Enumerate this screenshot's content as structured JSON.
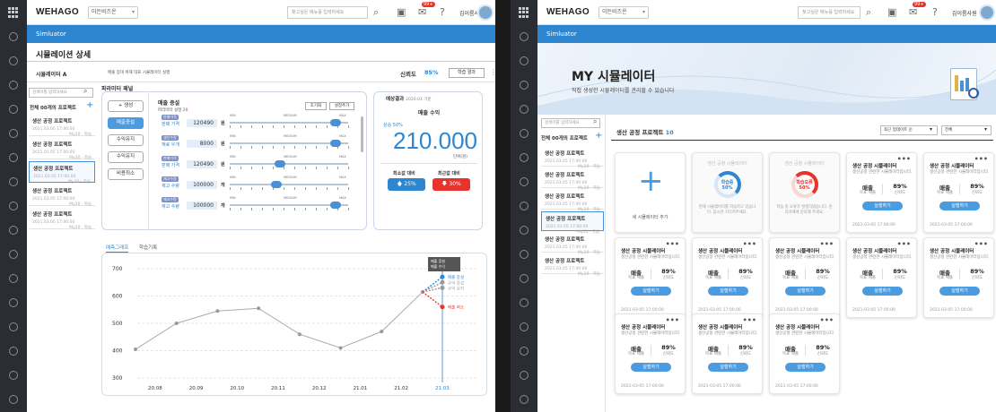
{
  "common": {
    "app_name": "WEHAGO",
    "corp_select": "이든비즈온",
    "search_placeholder": "찾고싶은 메뉴를 입력하세요",
    "user_name": "김이름사원",
    "chat_badge": "99+",
    "banner": "Simluator"
  },
  "left": {
    "page_title": "시뮬레이션 상세",
    "sim_name": "시뮬레이터 A",
    "sim_desc": "매출 증대 위해 대표 시뮬레이터 실행",
    "reliability_label": "신뢰도",
    "reliability_value": "85%",
    "learn_result_btn": "학습 결과",
    "list_search_placeholder": "검색어를 입력하세요",
    "project_header": "전체 00개의 프로젝트",
    "projects": [
      {
        "name": "생산 공정 프로젝트",
        "date": "2021.03.05 17:00:00",
        "meta": "My20 · 학습"
      },
      {
        "name": "생산 공정 프로젝트",
        "date": "2021.03.05 17:00:00",
        "meta": "My20 · 학습"
      },
      {
        "name": "생산 공정 프로젝트",
        "date": "2021.03.05 17:00:00",
        "meta": "My20 · 학습"
      },
      {
        "name": "생산 공정 프로젝트",
        "date": "2021.03.05 17:00:00",
        "meta": "My20 · 학습"
      },
      {
        "name": "생산 공정 프로젝트",
        "date": "2021.03.05 17:00:00",
        "meta": "My20 · 학습"
      }
    ],
    "param_panel_title": "파라미터 패널",
    "ops": [
      "+ 생성",
      "매출증설",
      "수익유지",
      "수익유지",
      "비용최소"
    ],
    "panel_title": "매출 증설",
    "panel_sub": "파라미터 설정",
    "panel_sub_count": "20",
    "reset_btn": "초기화",
    "add_btn": "설정추가",
    "params": [
      {
        "chip": "판매가격",
        "label": "판매 가격",
        "value": "120490",
        "unit": "원"
      },
      {
        "chip": "생산수량",
        "label": "재료 우개",
        "value": "8000",
        "unit": "원"
      },
      {
        "chip": "판매가격",
        "label": "판매 가격",
        "value": "120490",
        "unit": "원"
      },
      {
        "chip": "재고수량",
        "label": "재고 수량",
        "value": "100000",
        "unit": "개"
      },
      {
        "chip": "재고수량",
        "label": "재고 수량",
        "value": "100000",
        "unit": "개"
      }
    ],
    "slider_min": "MIN",
    "slider_mid": "MEDIUM",
    "slider_max": "MAX",
    "result_title": "예상결과",
    "result_date": "2020.03 기준",
    "result_metric": "매출 수익",
    "result_rate": "상승 50%",
    "result_value": "210.000",
    "result_unit": "단위(원)",
    "min_label": "최소값 대비",
    "min_value": "25%",
    "max_label": "최근값 대비",
    "max_value": "30%",
    "tabs": [
      "예측그래프",
      "학습기록"
    ],
    "tooltip_l1": "매출 증설",
    "tooltip_l2": "매출 수익",
    "legend": [
      "매출 증설",
      "수익 증설",
      "수익 유지",
      "매출 최소"
    ]
  },
  "chart_data": {
    "type": "line",
    "x": [
      "20.08",
      "20.09",
      "20.10",
      "20.11",
      "20.12",
      "21.01",
      "21.02",
      "21.03"
    ],
    "ylim": [
      300,
      700
    ],
    "yticks": [
      300,
      400,
      500,
      600,
      700
    ],
    "series": [
      {
        "values": [
          405,
          500,
          545,
          555,
          460,
          410,
          470,
          615
        ]
      }
    ],
    "projections": [
      {
        "name": "매출 증설",
        "end": 670,
        "color": "#2f86d0"
      },
      {
        "name": "수익 증설",
        "end": 650,
        "color": "#999999"
      },
      {
        "name": "수익 유지",
        "end": 630,
        "color": "#999999"
      },
      {
        "name": "매출 최소",
        "end": 560,
        "color": "#e8322b"
      }
    ]
  },
  "right": {
    "hero_title": "MY 시뮬레이터",
    "hero_sub": "직접 생성한 시뮬레이터를 관리할 수 있습니다",
    "list_search_placeholder": "검색어를 입력하세요",
    "project_header": "전체 00개의 프로젝트",
    "projects": [
      {
        "name": "생산 공정 프로젝트",
        "date": "2021.03.05 17:00:00",
        "meta": "My20 · 학습"
      },
      {
        "name": "생산 공정 프로젝트",
        "date": "2021.03.05 17:00:00",
        "meta": "My20 · 학습"
      },
      {
        "name": "생산 공정 프로젝트",
        "date": "2021.03.05 17:00:00",
        "meta": "My20 · 학습"
      },
      {
        "name": "생산 공정 프로젝트",
        "date": "2021.03.05 17:00:00",
        "meta": "My20 · 학습"
      },
      {
        "name": "생산 공정 프로젝트",
        "date": "2021.03.05 17:00:00",
        "meta": "My20 · 학습"
      },
      {
        "name": "생산 공정 프로젝트",
        "date": "2021.03.05 17:00:00",
        "meta": "My20 · 학습"
      }
    ],
    "grid_title": "생산 공정 프로젝트",
    "grid_count": "10",
    "sort_select": "최근 업데이트 순",
    "filter_select": "전체",
    "add_card": "새 시뮬레이터 추가",
    "learning": {
      "title": "생산 공정 시뮬레이터",
      "status": "학습중",
      "pct": "50%",
      "progress": 0.5,
      "desc": "현재 시뮬레이터를 학습하고 있습니다. 잠시만 기다려주세요."
    },
    "error": {
      "title": "생산 공정 시뮬레이터",
      "status": "학습오류",
      "pct": "50%",
      "progress": 0.5,
      "desc": "학습 중 오류가 발생하였습니다. 관리자에게 문의해 주세요."
    },
    "card": {
      "title": "생산 공정 시뮬레이터",
      "desc": "생산공정 관련한 시뮬레이터입니다.",
      "m1": "매출",
      "m1l": "목표 매출",
      "m2": "89%",
      "m2l": "신뢰도",
      "run": "실행하기",
      "date": "2021-03-05 17:00:00"
    }
  }
}
